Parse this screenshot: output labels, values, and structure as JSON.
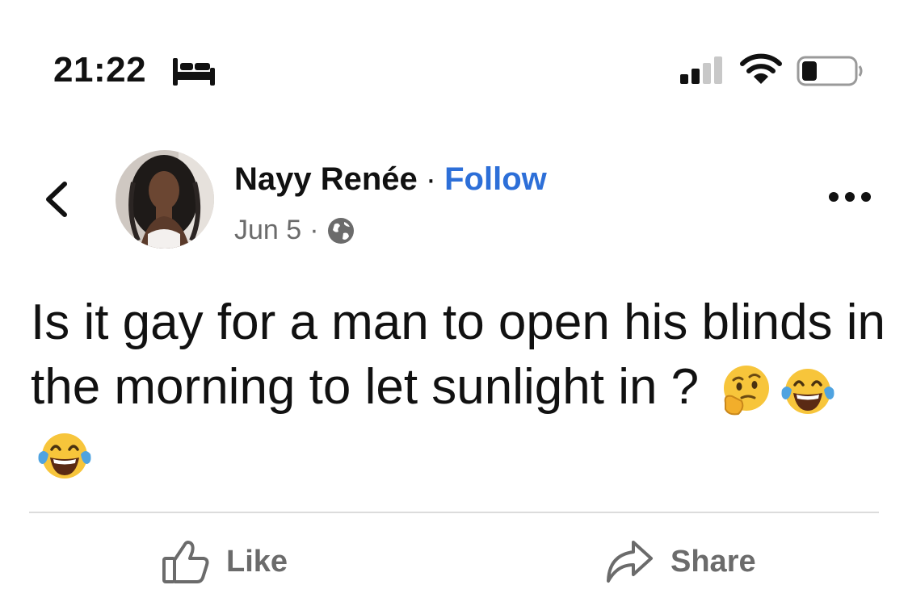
{
  "status_bar": {
    "time": "21:22",
    "icons": [
      "bed-icon",
      "cellular-signal-icon",
      "wifi-icon",
      "battery-icon"
    ]
  },
  "post": {
    "author_name": "Nayy Renée",
    "separator": "·",
    "follow_label": "Follow",
    "date": "Jun 5",
    "audience_icon": "globe-icon",
    "text": "Is it gay for a man to open his blinds in the morning to let sunlight in ?",
    "emojis": [
      "thinking-face-emoji",
      "tears-of-joy-emoji",
      "tears-of-joy-emoji"
    ]
  },
  "actions": {
    "like_label": "Like",
    "share_label": "Share"
  },
  "colors": {
    "link": "#2d6fd8",
    "muted_text": "#6b6b6b",
    "divider": "#dcdcdc"
  }
}
